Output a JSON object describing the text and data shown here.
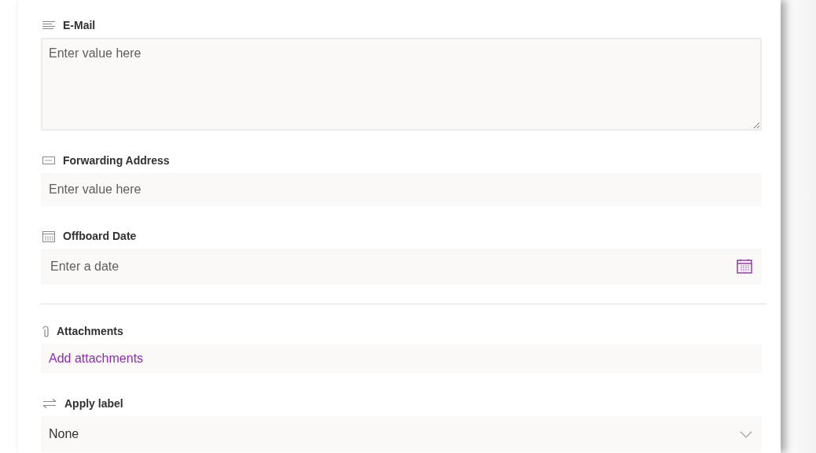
{
  "fields": [
    {
      "kind": "multiline",
      "label": "E-Mail",
      "placeholder": "Enter value here",
      "divider_before": false
    },
    {
      "kind": "text",
      "label": "Forwarding Address",
      "placeholder": "Enter value here",
      "divider_before": false
    },
    {
      "kind": "date",
      "label": "Offboard Date",
      "placeholder": "Enter a date",
      "divider_before": false
    },
    {
      "kind": "attachments",
      "label": "Attachments",
      "link": "Add attachments",
      "divider_before": true
    },
    {
      "kind": "dropdown",
      "label": "Apply label",
      "value": "None",
      "divider_before": false
    }
  ]
}
